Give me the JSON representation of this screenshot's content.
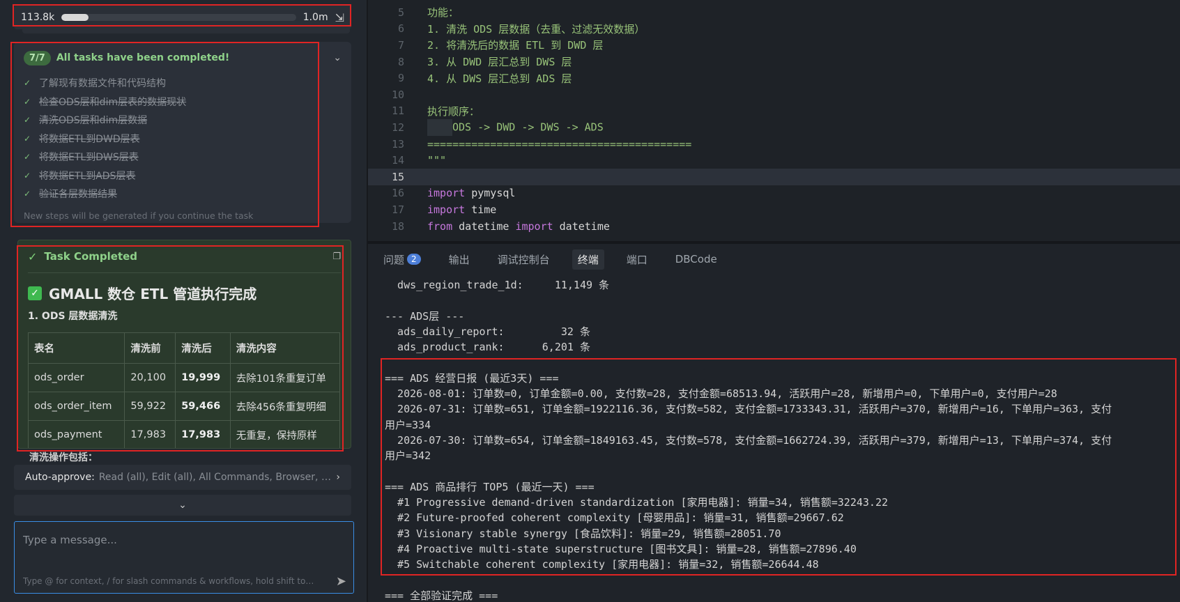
{
  "context": {
    "used": "113.8k",
    "max": "1.0m",
    "progress": 0.114
  },
  "tasks": {
    "badge": "7/7",
    "title": "All tasks have been completed!",
    "items": [
      {
        "label": "了解现有数据文件和代码结构",
        "strike": false
      },
      {
        "label": "检查ODS层和dim层表的数据现状",
        "strike": true
      },
      {
        "label": "清洗ODS层和dim层数据",
        "strike": true
      },
      {
        "label": "将数据ETL到DWD层表",
        "strike": true
      },
      {
        "label": "将数据ETL到DWS层表",
        "strike": true
      },
      {
        "label": "将数据ETL到ADS层表",
        "strike": true
      },
      {
        "label": "验证各层数据结果",
        "strike": true
      }
    ],
    "hint": "New steps will be generated if you continue the task"
  },
  "completion": {
    "header": "Task Completed",
    "heading": "GMALL 数仓 ETL 管道执行完成",
    "subheading": "1. ODS 层数据清洗",
    "table": {
      "headers": [
        "表名",
        "清洗前",
        "清洗后",
        "清洗内容"
      ],
      "rows": [
        [
          "ods_order",
          "20,100",
          "19,999",
          "去除101条重复订单"
        ],
        [
          "ods_order_item",
          "59,922",
          "59,466",
          "去除456条重复明细"
        ],
        [
          "ods_payment",
          "17,983",
          "17,983",
          "无重复，保持原样"
        ]
      ]
    },
    "cut_text": "清洗操作包括："
  },
  "approve": {
    "label": "Auto-approve:",
    "values": "Read (all), Edit (all), All Commands, Browser, MCP"
  },
  "message": {
    "placeholder": "Type a message...",
    "hint": "Type @ for context, / for slash commands & workflows, hold shift to drag in files/images"
  },
  "editor": {
    "active_line": 15,
    "lines": [
      {
        "n": "5",
        "text": "功能："
      },
      {
        "n": "6",
        "text": "1. 清洗 ODS 层数据（去重、过滤无效数据）"
      },
      {
        "n": "7",
        "text": "2. 将清洗后的数据 ETL 到 DWD 层"
      },
      {
        "n": "8",
        "text": "3. 从 DWD 层汇总到 DWS 层"
      },
      {
        "n": "9",
        "text": "4. 从 DWS 层汇总到 ADS 层"
      },
      {
        "n": "10",
        "text": ""
      },
      {
        "n": "11",
        "text": "执行顺序："
      },
      {
        "n": "12",
        "text": "ODS -> DWD -> DWS -> ADS"
      },
      {
        "n": "13",
        "text": "=========================================="
      },
      {
        "n": "14",
        "text": "\"\"\""
      },
      {
        "n": "15",
        "text": ""
      },
      {
        "n": "16",
        "kw": "import",
        "rest": " pymysql"
      },
      {
        "n": "17",
        "kw": "import",
        "rest": " time"
      },
      {
        "n": "18",
        "kw": "from",
        "mid": " datetime ",
        "kw2": "import",
        "rest": " datetime"
      }
    ]
  },
  "terminal": {
    "tabs": [
      {
        "label": "问题",
        "badge": "2"
      },
      {
        "label": "输出"
      },
      {
        "label": "调试控制台"
      },
      {
        "label": "终端",
        "active": true
      },
      {
        "label": "端口"
      },
      {
        "label": "DBCode"
      }
    ],
    "lines": [
      "  dws_region_trade_1d:     11,149 条",
      "",
      "--- ADS层 ---",
      "  ads_daily_report:         32 条",
      "  ads_product_rank:      6,201 条",
      "",
      "=== ADS 经营日报 (最近3天) ===",
      "  2026-08-01: 订单数=0, 订单金额=0.00, 支付数=28, 支付金额=68513.94, 活跃用户=28, 新增用户=0, 下单用户=0, 支付用户=28",
      "  2026-07-31: 订单数=651, 订单金额=1922116.36, 支付数=582, 支付金额=1733343.31, 活跃用户=370, 新增用户=16, 下单用户=363, 支付",
      "用户=334",
      "  2026-07-30: 订单数=654, 订单金额=1849163.45, 支付数=578, 支付金额=1662724.39, 活跃用户=379, 新增用户=13, 下单用户=374, 支付",
      "用户=342",
      "",
      "=== ADS 商品排行 TOP5 (最近一天) ===",
      "  #1 Progressive demand-driven standardization [家用电器]: 销量=34, 销售额=32243.22",
      "  #2 Future-proofed coherent complexity [母婴用品]: 销量=31, 销售额=29667.62",
      "  #3 Visionary stable synergy [食品饮料]: 销量=29, 销售额=28051.70",
      "  #4 Proactive multi-state superstructure [图书文具]: 销量=28, 销售额=27896.40",
      "  #5 Switchable coherent complexity [家用电器]: 销量=32, 销售额=26644.48",
      "",
      "=== 全部验证完成 ==="
    ]
  }
}
